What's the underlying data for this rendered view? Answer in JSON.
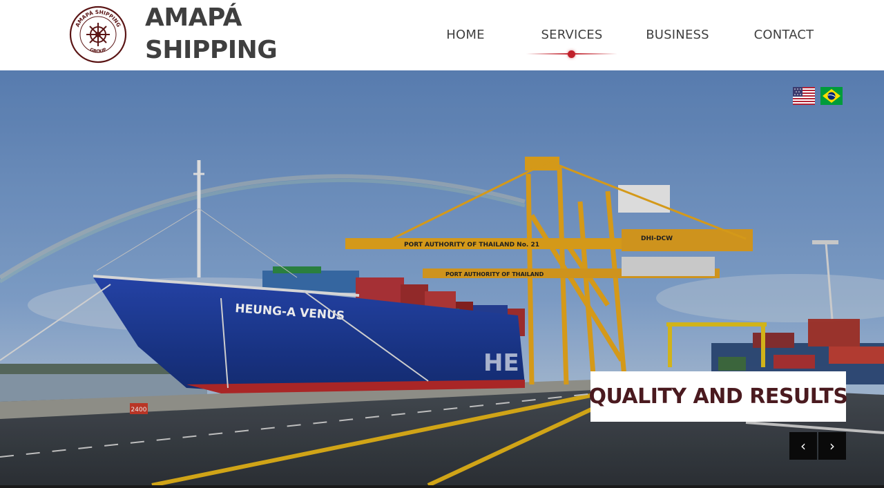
{
  "brand": {
    "line1": "AMAPÁ",
    "line2": "SHIPPING",
    "logo_top_text": "AMAPÁ SHIPPING",
    "logo_bottom_text": "GROUP",
    "logo_icon": "ship-wheel-icon"
  },
  "nav": {
    "items": [
      {
        "label": "HOME",
        "active": false
      },
      {
        "label": "SERVICES",
        "active": true
      },
      {
        "label": "BUSINESS",
        "active": false
      },
      {
        "label": "CONTACT",
        "active": false
      }
    ],
    "active_color": "#c0202a"
  },
  "language": {
    "options": [
      {
        "name": "English",
        "icon": "us-flag-icon"
      },
      {
        "name": "Português",
        "icon": "brazil-flag-icon"
      }
    ]
  },
  "hero": {
    "caption": "QUALITY AND RESULTS",
    "ship_name": "HEUNG-A VENUS",
    "crane_sign_1": "PORT AUTHORITY OF THAILAND No. 21",
    "crane_sign_2": "PORT AUTHORITY OF THAILAND",
    "crane_tag": "DHI-DCW",
    "quay_marker": "2400",
    "hull_letters": "HE",
    "prev_icon": "chevron-left-icon",
    "next_icon": "chevron-right-icon",
    "prev_label": "‹",
    "next_label": "›"
  },
  "colors": {
    "brand_text": "#3f3f3f",
    "caption_text": "#4a1a1f",
    "accent": "#c0202a",
    "sky": "#6e95c9",
    "ship_hull": "#1c3fa0"
  }
}
